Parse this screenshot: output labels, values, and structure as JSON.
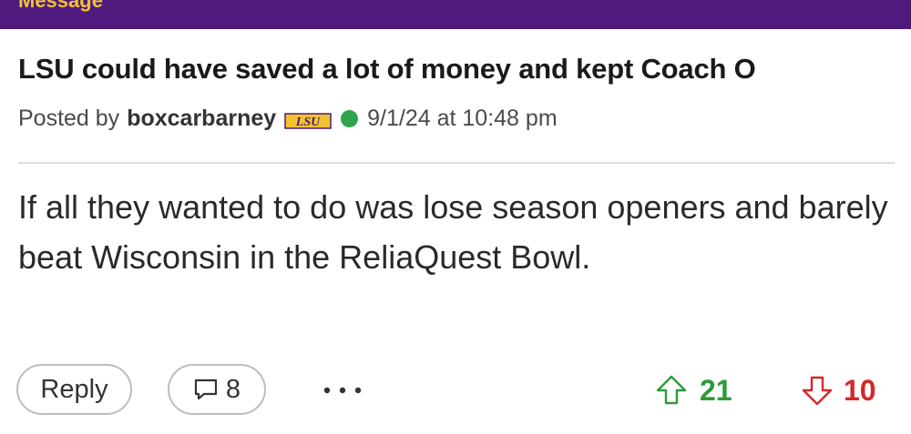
{
  "header": {
    "label": "Message"
  },
  "post": {
    "title": "LSU could have saved a lot of money and kept Coach O",
    "posted_by_label": "Posted by",
    "author": "boxcarbarney",
    "team_logo": "LSU",
    "timestamp": "9/1/24 at 10:48 pm",
    "body": "If all they wanted to do was lose season openers and barely beat Wisconsin in the ReliaQuest Bowl."
  },
  "actions": {
    "reply_label": "Reply",
    "comment_count": "8",
    "more_label": "...",
    "upvotes": "21",
    "downvotes": "10"
  },
  "colors": {
    "brand_purple": "#4e1a7e",
    "brand_gold": "#f2c230",
    "online": "#2ea44f",
    "upvote": "#2f9a3a",
    "downvote": "#d62828"
  },
  "icons": [
    "team-logo-icon",
    "online-status-icon",
    "comment-icon",
    "more-icon",
    "upvote-arrow-icon",
    "downvote-arrow-icon"
  ]
}
